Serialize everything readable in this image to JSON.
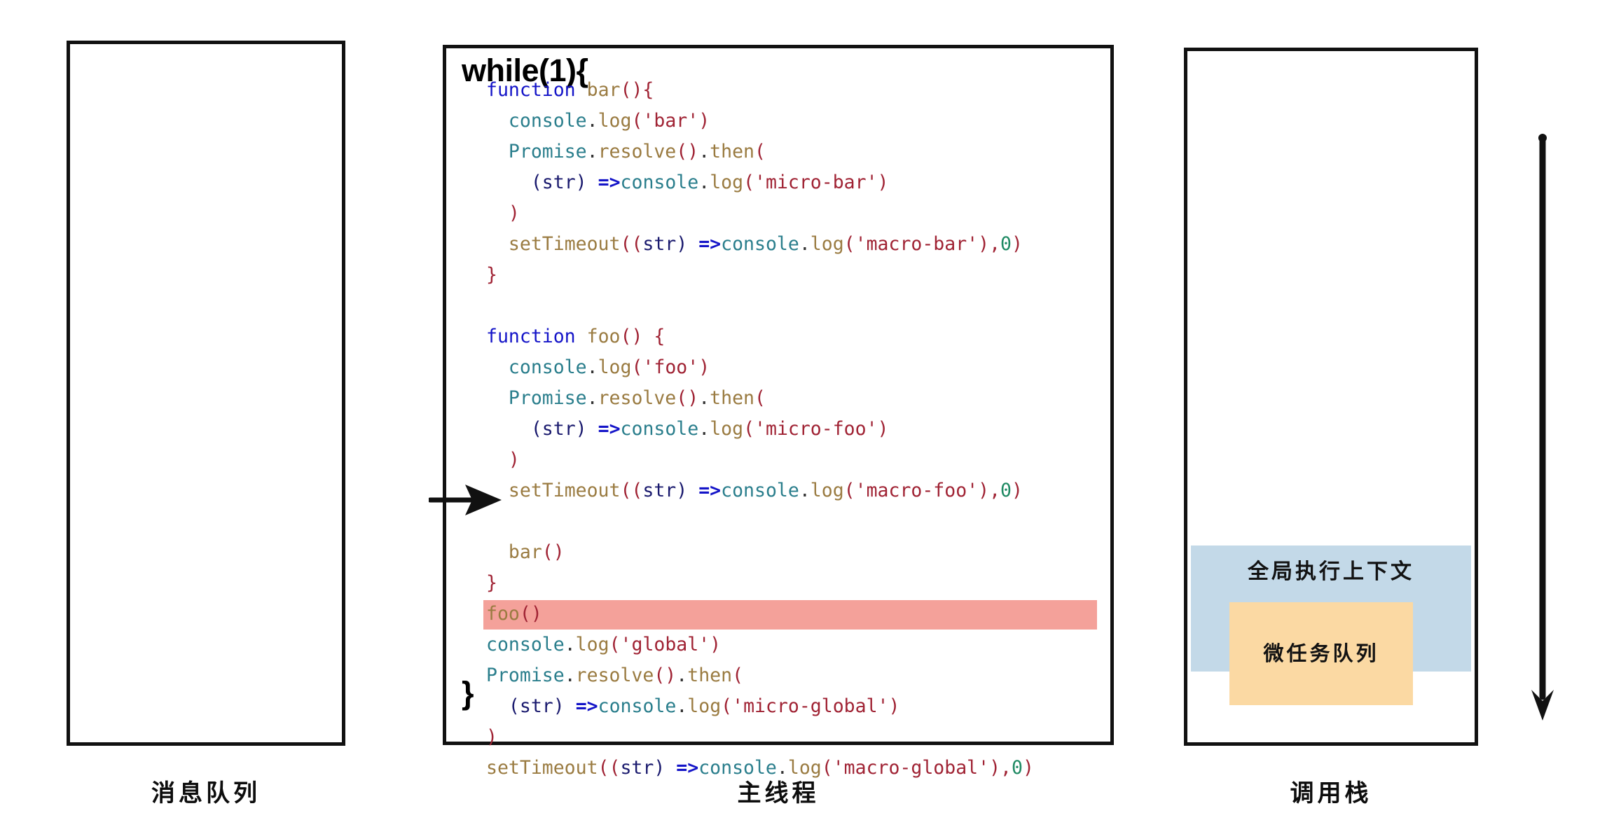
{
  "diagram": {
    "panels": {
      "message_queue": {
        "caption": "消息队列"
      },
      "main_thread": {
        "caption": "主线程",
        "loop_header": "while(1){",
        "loop_footer": "}"
      },
      "call_stack": {
        "caption": "调用栈",
        "global_context_label": "全局执行上下文",
        "microtask_queue_label": "微任务队列"
      }
    },
    "code_lines": [
      {
        "id": 1,
        "indent": 0,
        "highlight": false,
        "tokens": [
          {
            "t": "function",
            "c": "t-kw"
          },
          {
            "t": " ",
            "c": "t-plain"
          },
          {
            "t": "bar",
            "c": "t-fn"
          },
          {
            "t": "(){",
            "c": "t-punct"
          }
        ]
      },
      {
        "id": 2,
        "indent": 1,
        "highlight": false,
        "tokens": [
          {
            "t": "console",
            "c": "t-obj"
          },
          {
            "t": ".",
            "c": "t-dot"
          },
          {
            "t": "log",
            "c": "t-fn"
          },
          {
            "t": "(",
            "c": "t-punct"
          },
          {
            "t": "'bar'",
            "c": "t-str"
          },
          {
            "t": ")",
            "c": "t-punct"
          }
        ]
      },
      {
        "id": 3,
        "indent": 1,
        "highlight": false,
        "tokens": [
          {
            "t": "Promise",
            "c": "t-obj"
          },
          {
            "t": ".",
            "c": "t-dot"
          },
          {
            "t": "resolve",
            "c": "t-fn"
          },
          {
            "t": "()",
            "c": "t-punct"
          },
          {
            "t": ".",
            "c": "t-dot"
          },
          {
            "t": "then",
            "c": "t-fn"
          },
          {
            "t": "(",
            "c": "t-punct"
          }
        ]
      },
      {
        "id": 4,
        "indent": 2,
        "highlight": false,
        "tokens": [
          {
            "t": "(",
            "c": "t-paren"
          },
          {
            "t": "str",
            "c": "t-param"
          },
          {
            "t": ")",
            "c": "t-paren"
          },
          {
            "t": " ",
            "c": "t-plain"
          },
          {
            "t": "=>",
            "c": "t-arrow"
          },
          {
            "t": "console",
            "c": "t-obj"
          },
          {
            "t": ".",
            "c": "t-dot"
          },
          {
            "t": "log",
            "c": "t-fn"
          },
          {
            "t": "(",
            "c": "t-punct"
          },
          {
            "t": "'micro-bar'",
            "c": "t-str"
          },
          {
            "t": ")",
            "c": "t-punct"
          }
        ]
      },
      {
        "id": 5,
        "indent": 1,
        "highlight": false,
        "tokens": [
          {
            "t": ")",
            "c": "t-punct"
          }
        ]
      },
      {
        "id": 6,
        "indent": 1,
        "highlight": false,
        "tokens": [
          {
            "t": "setTimeout",
            "c": "t-fn"
          },
          {
            "t": "((",
            "c": "t-punct"
          },
          {
            "t": "str",
            "c": "t-param"
          },
          {
            "t": ")",
            "c": "t-paren"
          },
          {
            "t": " ",
            "c": "t-plain"
          },
          {
            "t": "=>",
            "c": "t-arrow"
          },
          {
            "t": "console",
            "c": "t-obj"
          },
          {
            "t": ".",
            "c": "t-dot"
          },
          {
            "t": "log",
            "c": "t-fn"
          },
          {
            "t": "(",
            "c": "t-punct"
          },
          {
            "t": "'macro-bar'",
            "c": "t-str"
          },
          {
            "t": "),",
            "c": "t-punct"
          },
          {
            "t": "0",
            "c": "t-num"
          },
          {
            "t": ")",
            "c": "t-punct"
          }
        ]
      },
      {
        "id": 7,
        "indent": 0,
        "highlight": false,
        "tokens": [
          {
            "t": "}",
            "c": "t-punct"
          }
        ]
      },
      {
        "id": 8,
        "indent": 0,
        "highlight": false,
        "blank": true,
        "tokens": []
      },
      {
        "id": 9,
        "indent": 0,
        "highlight": false,
        "tokens": [
          {
            "t": "function",
            "c": "t-kw"
          },
          {
            "t": " ",
            "c": "t-plain"
          },
          {
            "t": "foo",
            "c": "t-fn"
          },
          {
            "t": "() {",
            "c": "t-punct"
          }
        ]
      },
      {
        "id": 10,
        "indent": 1,
        "highlight": false,
        "tokens": [
          {
            "t": "console",
            "c": "t-obj"
          },
          {
            "t": ".",
            "c": "t-dot"
          },
          {
            "t": "log",
            "c": "t-fn"
          },
          {
            "t": "(",
            "c": "t-punct"
          },
          {
            "t": "'foo'",
            "c": "t-str"
          },
          {
            "t": ")",
            "c": "t-punct"
          }
        ]
      },
      {
        "id": 11,
        "indent": 1,
        "highlight": false,
        "tokens": [
          {
            "t": "Promise",
            "c": "t-obj"
          },
          {
            "t": ".",
            "c": "t-dot"
          },
          {
            "t": "resolve",
            "c": "t-fn"
          },
          {
            "t": "()",
            "c": "t-punct"
          },
          {
            "t": ".",
            "c": "t-dot"
          },
          {
            "t": "then",
            "c": "t-fn"
          },
          {
            "t": "(",
            "c": "t-punct"
          }
        ]
      },
      {
        "id": 12,
        "indent": 2,
        "highlight": false,
        "tokens": [
          {
            "t": "(",
            "c": "t-paren"
          },
          {
            "t": "str",
            "c": "t-param"
          },
          {
            "t": ")",
            "c": "t-paren"
          },
          {
            "t": " ",
            "c": "t-plain"
          },
          {
            "t": "=>",
            "c": "t-arrow"
          },
          {
            "t": "console",
            "c": "t-obj"
          },
          {
            "t": ".",
            "c": "t-dot"
          },
          {
            "t": "log",
            "c": "t-fn"
          },
          {
            "t": "(",
            "c": "t-punct"
          },
          {
            "t": "'micro-foo'",
            "c": "t-str"
          },
          {
            "t": ")",
            "c": "t-punct"
          }
        ]
      },
      {
        "id": 13,
        "indent": 1,
        "highlight": false,
        "tokens": [
          {
            "t": ")",
            "c": "t-punct"
          }
        ]
      },
      {
        "id": 14,
        "indent": 1,
        "highlight": false,
        "tokens": [
          {
            "t": "setTimeout",
            "c": "t-fn"
          },
          {
            "t": "((",
            "c": "t-punct"
          },
          {
            "t": "str",
            "c": "t-param"
          },
          {
            "t": ")",
            "c": "t-paren"
          },
          {
            "t": " ",
            "c": "t-plain"
          },
          {
            "t": "=>",
            "c": "t-arrow"
          },
          {
            "t": "console",
            "c": "t-obj"
          },
          {
            "t": ".",
            "c": "t-dot"
          },
          {
            "t": "log",
            "c": "t-fn"
          },
          {
            "t": "(",
            "c": "t-punct"
          },
          {
            "t": "'macro-foo'",
            "c": "t-str"
          },
          {
            "t": "),",
            "c": "t-punct"
          },
          {
            "t": "0",
            "c": "t-num"
          },
          {
            "t": ")",
            "c": "t-punct"
          }
        ]
      },
      {
        "id": 15,
        "indent": 0,
        "highlight": false,
        "blank": true,
        "tokens": []
      },
      {
        "id": 16,
        "indent": 1,
        "highlight": false,
        "tokens": [
          {
            "t": "bar",
            "c": "t-fn"
          },
          {
            "t": "()",
            "c": "t-punct"
          }
        ]
      },
      {
        "id": 17,
        "indent": 0,
        "highlight": false,
        "tokens": [
          {
            "t": "}",
            "c": "t-punct"
          }
        ]
      },
      {
        "id": 18,
        "indent": 0,
        "highlight": true,
        "tokens": [
          {
            "t": "foo",
            "c": "t-fn"
          },
          {
            "t": "()",
            "c": "t-punct"
          }
        ]
      },
      {
        "id": 19,
        "indent": 0,
        "highlight": false,
        "tokens": [
          {
            "t": "console",
            "c": "t-obj"
          },
          {
            "t": ".",
            "c": "t-dot"
          },
          {
            "t": "log",
            "c": "t-fn"
          },
          {
            "t": "(",
            "c": "t-punct"
          },
          {
            "t": "'global'",
            "c": "t-str"
          },
          {
            "t": ")",
            "c": "t-punct"
          }
        ]
      },
      {
        "id": 20,
        "indent": 0,
        "highlight": false,
        "tokens": [
          {
            "t": "Promise",
            "c": "t-obj"
          },
          {
            "t": ".",
            "c": "t-dot"
          },
          {
            "t": "resolve",
            "c": "t-fn"
          },
          {
            "t": "()",
            "c": "t-punct"
          },
          {
            "t": ".",
            "c": "t-dot"
          },
          {
            "t": "then",
            "c": "t-fn"
          },
          {
            "t": "(",
            "c": "t-punct"
          }
        ]
      },
      {
        "id": 21,
        "indent": 1,
        "highlight": false,
        "tokens": [
          {
            "t": "(",
            "c": "t-paren"
          },
          {
            "t": "str",
            "c": "t-param"
          },
          {
            "t": ")",
            "c": "t-paren"
          },
          {
            "t": " ",
            "c": "t-plain"
          },
          {
            "t": "=>",
            "c": "t-arrow"
          },
          {
            "t": "console",
            "c": "t-obj"
          },
          {
            "t": ".",
            "c": "t-dot"
          },
          {
            "t": "log",
            "c": "t-fn"
          },
          {
            "t": "(",
            "c": "t-punct"
          },
          {
            "t": "'micro-global'",
            "c": "t-str"
          },
          {
            "t": ")",
            "c": "t-punct"
          }
        ]
      },
      {
        "id": 22,
        "indent": 0,
        "highlight": false,
        "tokens": [
          {
            "t": ")",
            "c": "t-punct"
          }
        ]
      },
      {
        "id": 23,
        "indent": 0,
        "highlight": false,
        "tokens": [
          {
            "t": "setTimeout",
            "c": "t-fn"
          },
          {
            "t": "((",
            "c": "t-punct"
          },
          {
            "t": "str",
            "c": "t-param"
          },
          {
            "t": ")",
            "c": "t-paren"
          },
          {
            "t": " ",
            "c": "t-plain"
          },
          {
            "t": "=>",
            "c": "t-arrow"
          },
          {
            "t": "console",
            "c": "t-obj"
          },
          {
            "t": ".",
            "c": "t-dot"
          },
          {
            "t": "log",
            "c": "t-fn"
          },
          {
            "t": "(",
            "c": "t-punct"
          },
          {
            "t": "'macro-global'",
            "c": "t-str"
          },
          {
            "t": "),",
            "c": "t-punct"
          },
          {
            "t": "0",
            "c": "t-num"
          },
          {
            "t": ")",
            "c": "t-punct"
          }
        ]
      }
    ],
    "colors": {
      "highlight_line": "#f4a19a",
      "global_context_bg": "#c3d9e8",
      "microtask_queue_bg": "#fbd9a3",
      "border": "#111111",
      "keyword": "#1414c8",
      "object": "#2a7e8c",
      "function": "#9a7b41",
      "string": "#a02334",
      "number": "#1f8a63"
    }
  }
}
